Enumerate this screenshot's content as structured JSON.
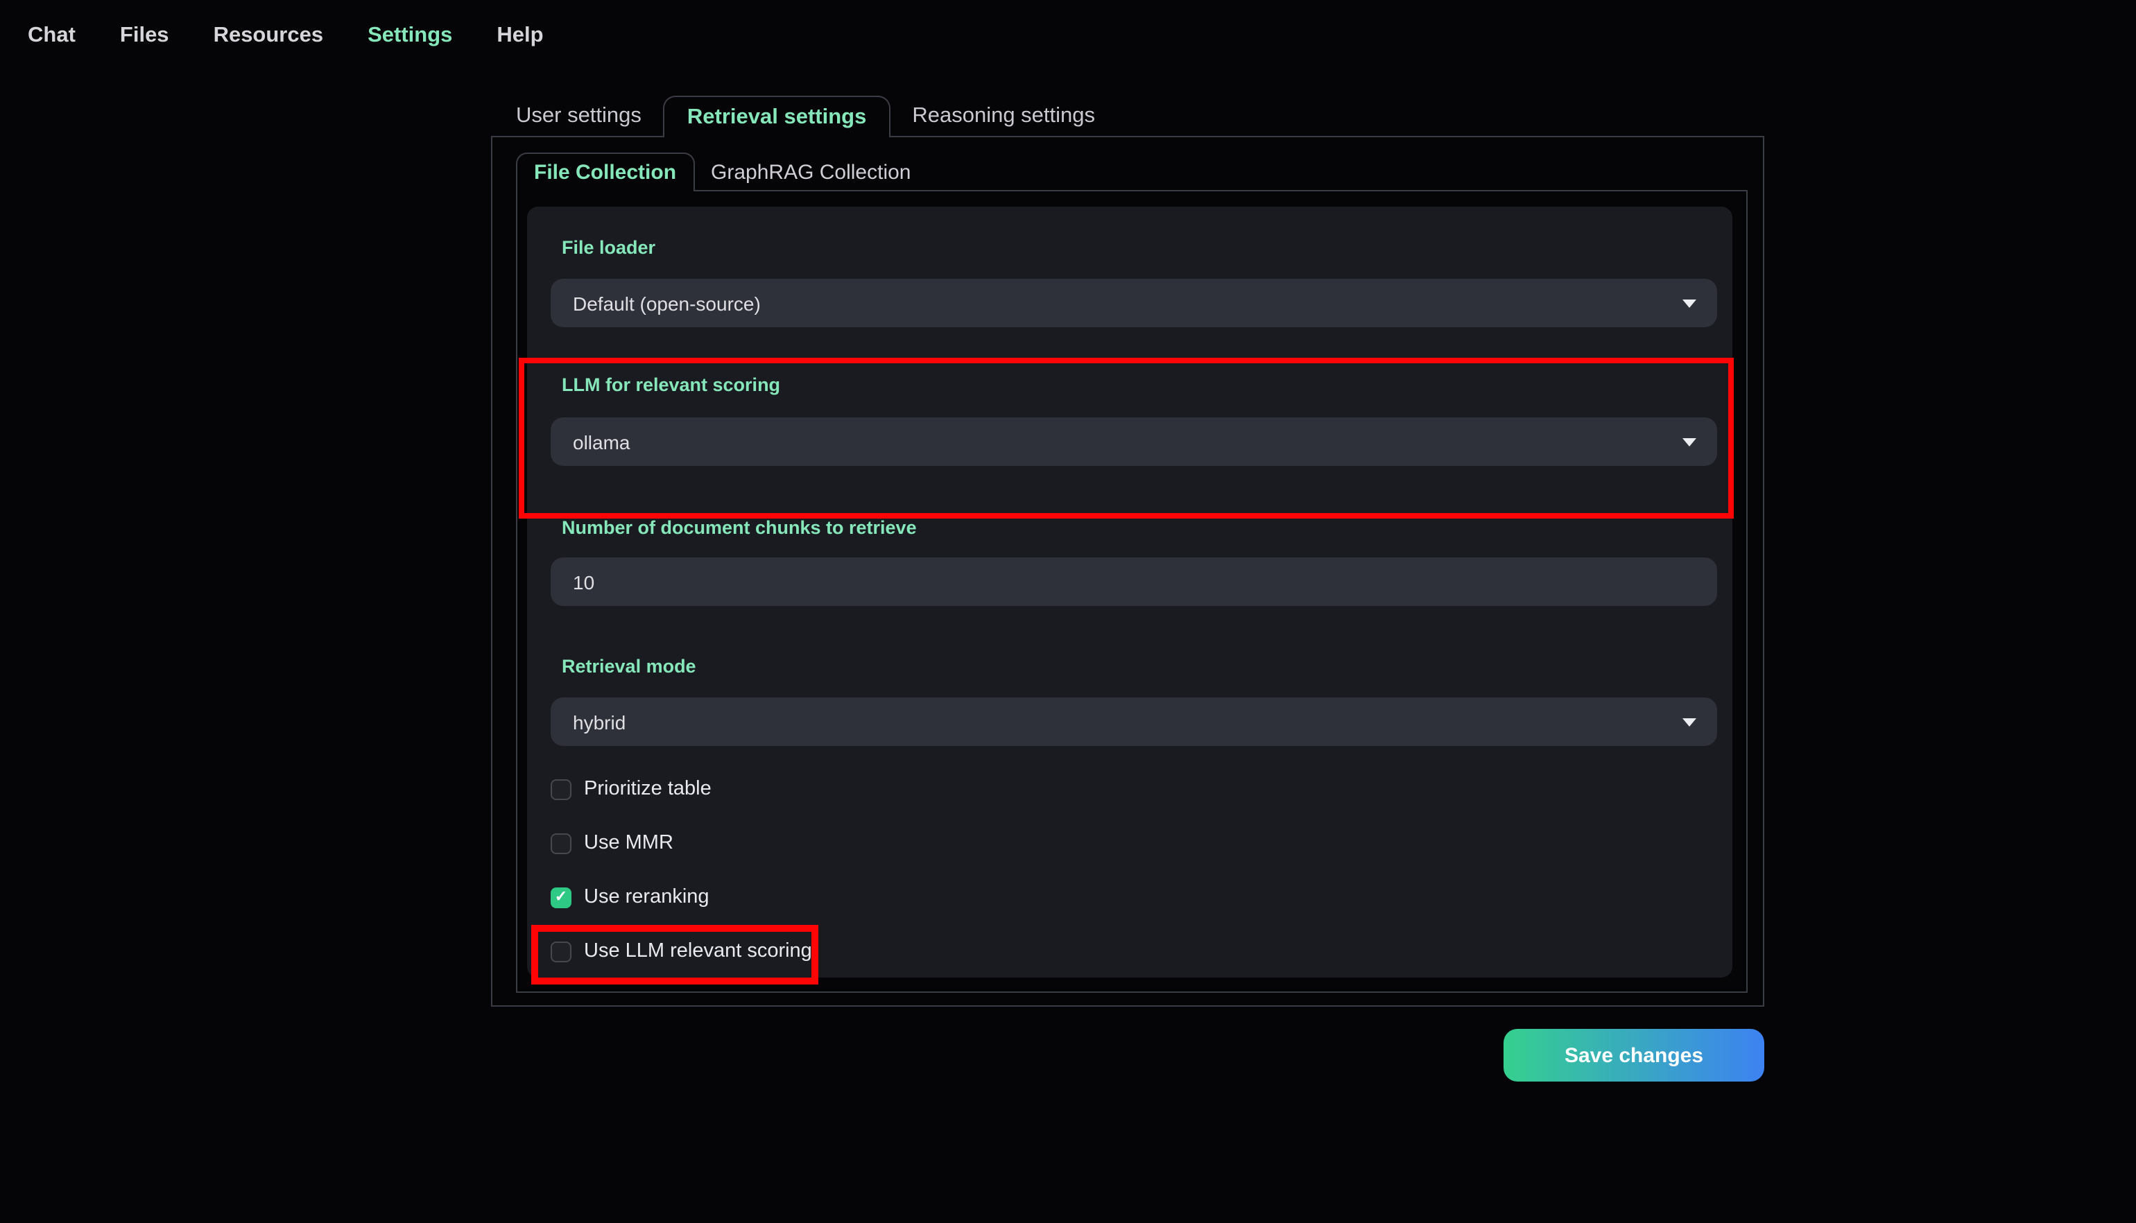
{
  "nav": {
    "items": [
      {
        "label": "Chat",
        "active": false
      },
      {
        "label": "Files",
        "active": false
      },
      {
        "label": "Resources",
        "active": false
      },
      {
        "label": "Settings",
        "active": true
      },
      {
        "label": "Help",
        "active": false
      }
    ]
  },
  "tabs": {
    "items": [
      {
        "label": "User settings",
        "active": false
      },
      {
        "label": "Retrieval settings",
        "active": true
      },
      {
        "label": "Reasoning settings",
        "active": false
      }
    ]
  },
  "subtabs": {
    "items": [
      {
        "label": "File Collection",
        "active": true
      },
      {
        "label": "GraphRAG Collection",
        "active": false
      }
    ]
  },
  "form": {
    "file_loader": {
      "label": "File loader",
      "value": "Default (open-source)"
    },
    "llm_relevant_scoring": {
      "label": "LLM for relevant scoring",
      "value": "ollama"
    },
    "num_chunks": {
      "label": "Number of document chunks to retrieve",
      "value": "10"
    },
    "retrieval_mode": {
      "label": "Retrieval mode",
      "value": "hybrid"
    },
    "checkboxes": [
      {
        "label": "Prioritize table",
        "checked": false
      },
      {
        "label": "Use MMR",
        "checked": false
      },
      {
        "label": "Use reranking",
        "checked": true
      },
      {
        "label": "Use LLM relevant scoring",
        "checked": false
      }
    ]
  },
  "save_button": {
    "label": "Save changes"
  },
  "icons": {
    "check_glyph": "✓"
  },
  "colors": {
    "accent_green_text": "#86e7ba",
    "checkbox_checked_green": "#2ec984",
    "annotation_red": "#fe0404",
    "save_gradient_start": "#35d08e",
    "save_gradient_end": "#3d82f2",
    "card_background": "#1a1b20",
    "input_background": "#2f313a"
  }
}
